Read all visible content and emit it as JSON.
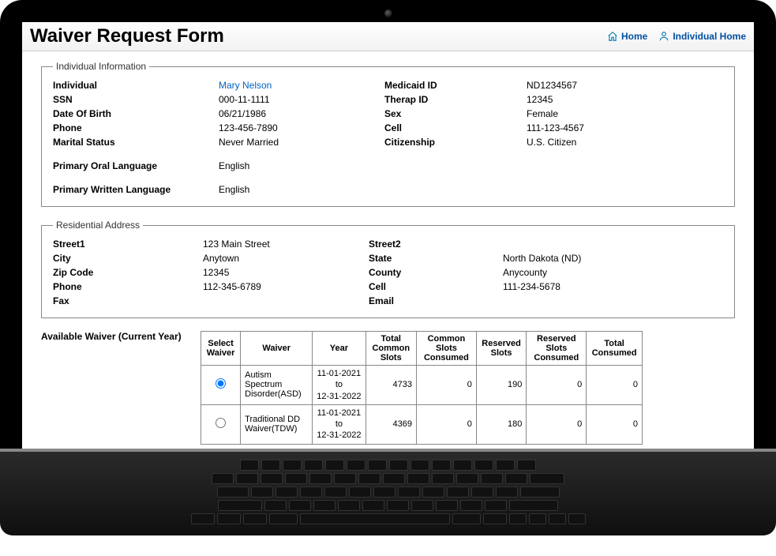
{
  "header": {
    "title": "Waiver Request Form",
    "nav": {
      "home": "Home",
      "individual_home": "Individual Home"
    }
  },
  "individual_info": {
    "legend": "Individual Information",
    "rows": {
      "individual_lbl": "Individual",
      "individual_val": "Mary Nelson",
      "medicaid_lbl": "Medicaid ID",
      "medicaid_val": "ND1234567",
      "ssn_lbl": "SSN",
      "ssn_val": "000-11-1111",
      "therap_lbl": "Therap ID",
      "therap_val": "12345",
      "dob_lbl": "Date Of Birth",
      "dob_val": "06/21/1986",
      "sex_lbl": "Sex",
      "sex_val": "Female",
      "phone_lbl": "Phone",
      "phone_val": "123-456-7890",
      "cell_lbl": "Cell",
      "cell_val": "111-123-4567",
      "marital_lbl": "Marital Status",
      "marital_val": "Never Married",
      "citizen_lbl": "Citizenship",
      "citizen_val": "U.S. Citizen",
      "oral_lang_lbl": "Primary Oral Language",
      "oral_lang_val": "English",
      "written_lang_lbl": "Primary Written Language",
      "written_lang_val": "English"
    }
  },
  "address": {
    "legend": "Residential Address",
    "street1_lbl": "Street1",
    "street1_val": "123 Main Street",
    "street2_lbl": "Street2",
    "street2_val": "",
    "city_lbl": "City",
    "city_val": "Anytown",
    "state_lbl": "State",
    "state_val": "North Dakota (ND)",
    "zip_lbl": "Zip Code",
    "zip_val": "12345",
    "county_lbl": "County",
    "county_val": "Anycounty",
    "phone_lbl": "Phone",
    "phone_val": "112-345-6789",
    "cell_lbl": "Cell",
    "cell_val": "111-234-5678",
    "fax_lbl": "Fax",
    "fax_val": "",
    "email_lbl": "Email",
    "email_val": ""
  },
  "waiver_section": {
    "label": "Available Waiver (Current Year)",
    "columns": {
      "select": "Select Waiver",
      "waiver": "Waiver",
      "year": "Year",
      "total_common": "Total Common Slots",
      "common_consumed": "Common Slots Consumed",
      "reserved": "Reserved Slots",
      "reserved_consumed": "Reserved Slots Consumed",
      "total_consumed": "Total Consumed"
    },
    "rows": [
      {
        "selected": true,
        "waiver": "Autism Spectrum Disorder(ASD)",
        "year_from": "11-01-2021",
        "year_to_word": "to",
        "year_to": "12-31-2022",
        "total_common": "4733",
        "common_consumed": "0",
        "reserved": "190",
        "reserved_consumed": "0",
        "total_consumed": "0"
      },
      {
        "selected": false,
        "waiver": "Traditional DD Waiver(TDW)",
        "year_from": "11-01-2021",
        "year_to_word": "to",
        "year_to": "12-31-2022",
        "total_common": "4369",
        "common_consumed": "0",
        "reserved": "180",
        "reserved_consumed": "0",
        "total_consumed": "0"
      }
    ]
  }
}
